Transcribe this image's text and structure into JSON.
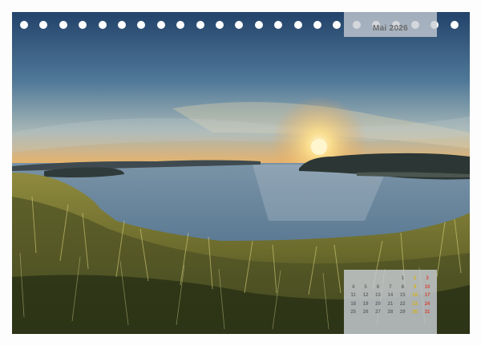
{
  "calendar": {
    "month_title": "Mai 2026",
    "weeks": [
      [
        "",
        "",
        "",
        "",
        "1",
        "2",
        "3"
      ],
      [
        "4",
        "5",
        "6",
        "7",
        "8",
        "9",
        "10"
      ],
      [
        "11",
        "12",
        "13",
        "14",
        "15",
        "16",
        "17"
      ],
      [
        "18",
        "19",
        "20",
        "21",
        "22",
        "23",
        "24"
      ],
      [
        "25",
        "26",
        "27",
        "28",
        "29",
        "30",
        "31"
      ]
    ]
  },
  "photo": {
    "subject": "sunset over bay with grassy foreground",
    "colors": {
      "sky_top": "#25476e",
      "sky_mid": "#5f86a6",
      "horizon": "#e9b36a",
      "sun": "#fff3c4",
      "water": "#6d8da7",
      "land": "#2f3a3a",
      "grass_light": "#a9a24a",
      "grass_dark": "#3b4521"
    }
  },
  "binding_hole_count": 23
}
